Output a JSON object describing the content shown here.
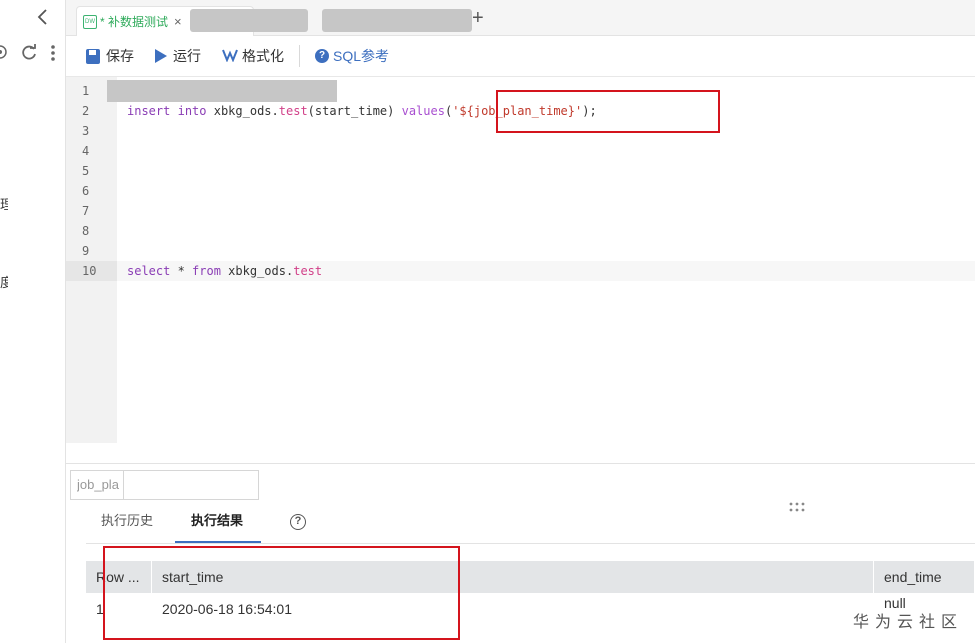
{
  "left_panel": {
    "back_icon": "chevron-left-icon",
    "icons": [
      "eye-icon",
      "refresh-icon",
      "more-vertical-icon"
    ],
    "labels": [
      "理",
      "度"
    ]
  },
  "tabs": {
    "active": {
      "icon": "DW",
      "title": "* 补数据测试",
      "close": "×"
    },
    "add": "+"
  },
  "toolbar": {
    "save_label": "保存",
    "run_label": "运行",
    "format_label": "格式化",
    "sql_ref_label": "SQL参考",
    "help_glyph": "?"
  },
  "editor": {
    "line_numbers": [
      "1",
      "2",
      "3",
      "4",
      "5",
      "6",
      "7",
      "8",
      "9",
      "10"
    ],
    "current_line": "10",
    "line2": {
      "kw1": "insert",
      "kw2": "into",
      "table": "xbkg_ods",
      "dot": ".",
      "prop": "test",
      "cols": "(start_time) ",
      "fn": "values",
      "open": "(",
      "str": "'${job_plan_time}'",
      "close": ");"
    },
    "line10": {
      "kw1": "select",
      "star": " * ",
      "kw2": "from",
      "table": " xbkg_ods",
      "dot": ".",
      "prop": "test"
    }
  },
  "bottom": {
    "param_label": "job_pla",
    "param_value": "",
    "drag_handle": "⠿",
    "tab_history": "执行历史",
    "tab_result": "执行结果",
    "help_glyph": "?",
    "result_table": {
      "columns": [
        "Row ...",
        "start_time",
        "end_time"
      ],
      "rows": [
        [
          "1",
          "2020-06-18 16:54:01",
          "null"
        ]
      ]
    },
    "watermark": "华为云社区"
  }
}
